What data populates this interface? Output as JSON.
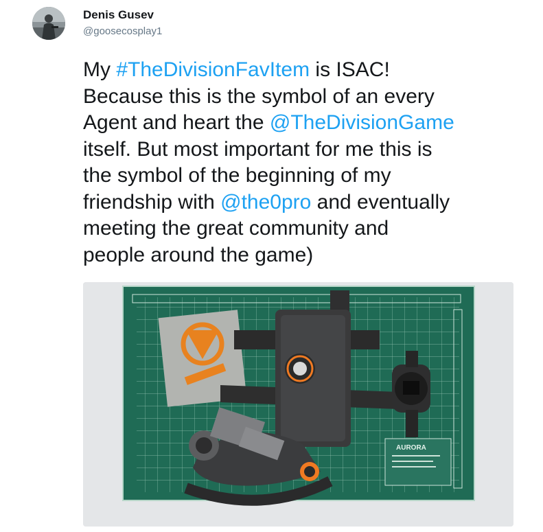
{
  "author": {
    "display_name": "Denis Gusev",
    "handle": "@goosecosplay1",
    "avatar_icon": "user-avatar-photo"
  },
  "tweet": {
    "text_before_hashtag": "My ",
    "hashtag": "#TheDivisionFavItem",
    "text_after_hashtag": " is ISAC! Because this is the symbol of an every Agent and heart the ",
    "mention_1": "@TheDivisionGame",
    "text_after_mention_1": " itself. But most important for me this is the symbol of the beginning of my friendship with ",
    "mention_2": "@the0pro",
    "text_after_mention_2": " and eventually meeting the great community and people around the game)"
  },
  "media": {
    "mat_brand": "AURORA",
    "icon": "photo-image"
  },
  "colors": {
    "link": "#1da1f2",
    "text": "#14171a",
    "handle": "#657786",
    "mat_green": "#1f6b55",
    "isac_orange": "#f07a22"
  }
}
